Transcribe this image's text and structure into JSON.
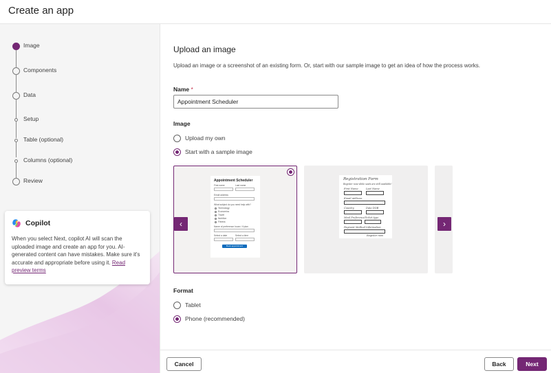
{
  "app": {
    "title": "Create an app"
  },
  "steps": [
    {
      "label": "Image",
      "state": "active"
    },
    {
      "label": "Components",
      "state": "upcoming"
    },
    {
      "label": "Data",
      "state": "upcoming"
    },
    {
      "label": "Setup",
      "state": "sub"
    },
    {
      "label": "Table (optional)",
      "state": "sub"
    },
    {
      "label": "Columns (optional)",
      "state": "sub"
    },
    {
      "label": "Review",
      "state": "upcoming"
    }
  ],
  "copilot": {
    "title": "Copilot",
    "text": "When you select Next, copilot AI will scan the uploaded image and create an app for you. AI-generated content can have mistakes. Make sure it's accurate and appropriate before using it.",
    "link": "Read preview terms"
  },
  "main": {
    "title": "Upload an image",
    "description": "Upload an image or a screenshot of an existing form. Or, start with our sample image to get an idea of how the process works.",
    "name_label": "Name",
    "name_required_mark": "*",
    "name_value": "Appointment Scheduler",
    "image_label": "Image",
    "image_options": [
      {
        "label": "Upload my own",
        "checked": false
      },
      {
        "label": "Start with a sample image",
        "checked": true
      }
    ],
    "format_label": "Format",
    "format_options": [
      {
        "label": "Tablet",
        "checked": false
      },
      {
        "label": "Phone (recommended)",
        "checked": true
      }
    ]
  },
  "samples": {
    "appointment": {
      "title": "Appointment Scheduler",
      "first_name": "First name",
      "last_name": "Last name",
      "email": "Email address",
      "subject_q": "What subject do you need help with?",
      "subjects": [
        "Technology",
        "Economics",
        "Travel",
        "Nutrition",
        "Fitness"
      ],
      "time_q": "Name of preference hours / if plan",
      "date_label": "Select a date",
      "time_label": "Select a time",
      "book_button": "Book appointment"
    },
    "registration": {
      "title": "Registration Form",
      "subtitle": "Register now while seats are still available!",
      "first_name": "First Name",
      "last_name": "Last Name",
      "email": "Email Address",
      "country": "Country",
      "dob": "Date DOB",
      "meal": "Meal Preference",
      "ticket": "Ticket type",
      "payment": "Payment Method Information",
      "register_button": "Register now"
    }
  },
  "nav": {
    "prev_icon": "‹",
    "next_icon": "›"
  },
  "footer": {
    "cancel": "Cancel",
    "back": "Back",
    "next": "Next"
  },
  "colors": {
    "accent": "#742774",
    "sidebar_bg": "#f5f5f5"
  }
}
